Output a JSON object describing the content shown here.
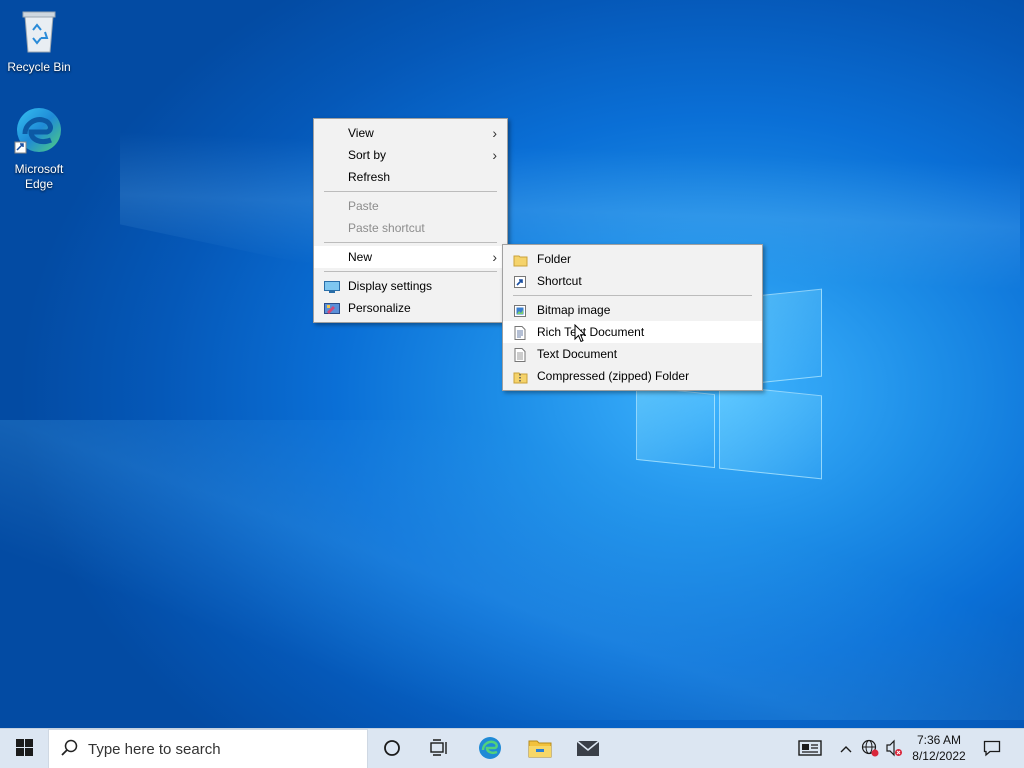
{
  "desktop": {
    "icons": [
      {
        "label": "Recycle Bin",
        "icon": "recycle-bin-icon"
      },
      {
        "label": "Microsoft Edge",
        "icon": "edge-icon"
      }
    ]
  },
  "context_menu": {
    "items": [
      {
        "label": "View",
        "has_submenu": true,
        "enabled": true
      },
      {
        "label": "Sort by",
        "has_submenu": true,
        "enabled": true
      },
      {
        "label": "Refresh",
        "enabled": true
      },
      {
        "label": "Paste",
        "enabled": false
      },
      {
        "label": "Paste shortcut",
        "enabled": false
      },
      {
        "label": "New",
        "has_submenu": true,
        "enabled": true,
        "highlighted": true
      },
      {
        "label": "Display settings",
        "icon": "display-icon",
        "enabled": true
      },
      {
        "label": "Personalize",
        "icon": "personalize-icon",
        "enabled": true
      }
    ],
    "arrow_glyph": ">"
  },
  "new_submenu": {
    "items": [
      {
        "label": "Folder",
        "icon": "folder-icon"
      },
      {
        "label": "Shortcut",
        "icon": "shortcut-icon"
      },
      {
        "label": "Bitmap image",
        "icon": "bitmap-icon"
      },
      {
        "label": "Rich Text Document",
        "icon": "rich-text-icon",
        "highlighted": true
      },
      {
        "label": "Text Document",
        "icon": "text-document-icon"
      },
      {
        "label": "Compressed (zipped) Folder",
        "icon": "zip-folder-icon"
      }
    ]
  },
  "taskbar": {
    "search_placeholder": "Type here to search",
    "pinned": [
      "start-icon",
      "cortana-icon",
      "task-view-icon",
      "edge-icon",
      "file-explorer-icon",
      "mail-icon"
    ],
    "tray": [
      "news-icon",
      "chevron-up-icon",
      "network-icon",
      "volume-muted-icon",
      "notification-icon"
    ],
    "time": "7:36 AM",
    "date": "8/12/2022"
  },
  "colors": {
    "wallpaper": "#0a6fd6",
    "taskbar": "#dce6f2",
    "menu_bg": "#f2f2f2"
  }
}
